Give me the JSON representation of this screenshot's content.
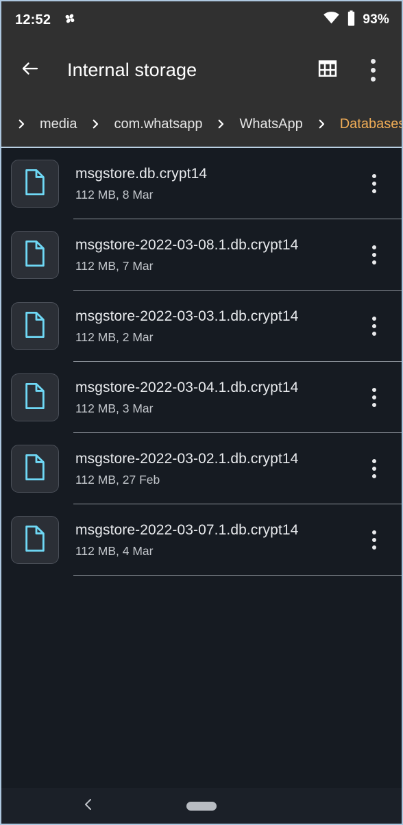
{
  "status_bar": {
    "clock": "12:52",
    "app_icon": "pinwheel-icon",
    "wifi_icon": "wifi-icon",
    "battery_icon": "battery-icon",
    "battery_percent": "93%"
  },
  "app_bar": {
    "back_icon": "back-arrow-icon",
    "title": "Internal storage",
    "grid_view_icon": "grid-view-icon",
    "overflow_icon": "overflow-menu-icon"
  },
  "breadcrumb": {
    "separator": "chevron-right-icon",
    "current_color": "#f0ac56",
    "items": [
      {
        "label": "media",
        "current": false
      },
      {
        "label": "com.whatsapp",
        "current": false
      },
      {
        "label": "WhatsApp",
        "current": false
      },
      {
        "label": "Databases",
        "current": true
      }
    ]
  },
  "file_list": {
    "icon": "document-file-icon",
    "row_menu_icon": "overflow-menu-icon",
    "items": [
      {
        "name": "msgstore.db.crypt14",
        "meta": "112 MB, 8 Mar",
        "size": "112 MB",
        "date": "8 Mar"
      },
      {
        "name": "msgstore-2022-03-08.1.db.crypt14",
        "meta": "112 MB, 7 Mar",
        "size": "112 MB",
        "date": "7 Mar"
      },
      {
        "name": "msgstore-2022-03-03.1.db.crypt14",
        "meta": "112 MB, 2 Mar",
        "size": "112 MB",
        "date": "2 Mar"
      },
      {
        "name": "msgstore-2022-03-04.1.db.crypt14",
        "meta": "112 MB, 3 Mar",
        "size": "112 MB",
        "date": "3 Mar"
      },
      {
        "name": "msgstore-2022-03-02.1.db.crypt14",
        "meta": "112 MB, 27 Feb",
        "size": "112 MB",
        "date": "27 Feb"
      },
      {
        "name": "msgstore-2022-03-07.1.db.crypt14",
        "meta": "112 MB, 4 Mar",
        "size": "112 MB",
        "date": "4 Mar"
      }
    ]
  },
  "nav_bar": {
    "back_icon": "nav-back-icon",
    "home_pill": "nav-home-pill"
  },
  "theme": {
    "chrome_bg": "#303030",
    "list_bg": "#161b22",
    "accent_orange": "#f0ac56",
    "file_icon_cyan": "#6fd8f5",
    "text_primary": "#e8eaed",
    "text_secondary": "#c3c7cc",
    "edge_border": "#aec8e0"
  }
}
